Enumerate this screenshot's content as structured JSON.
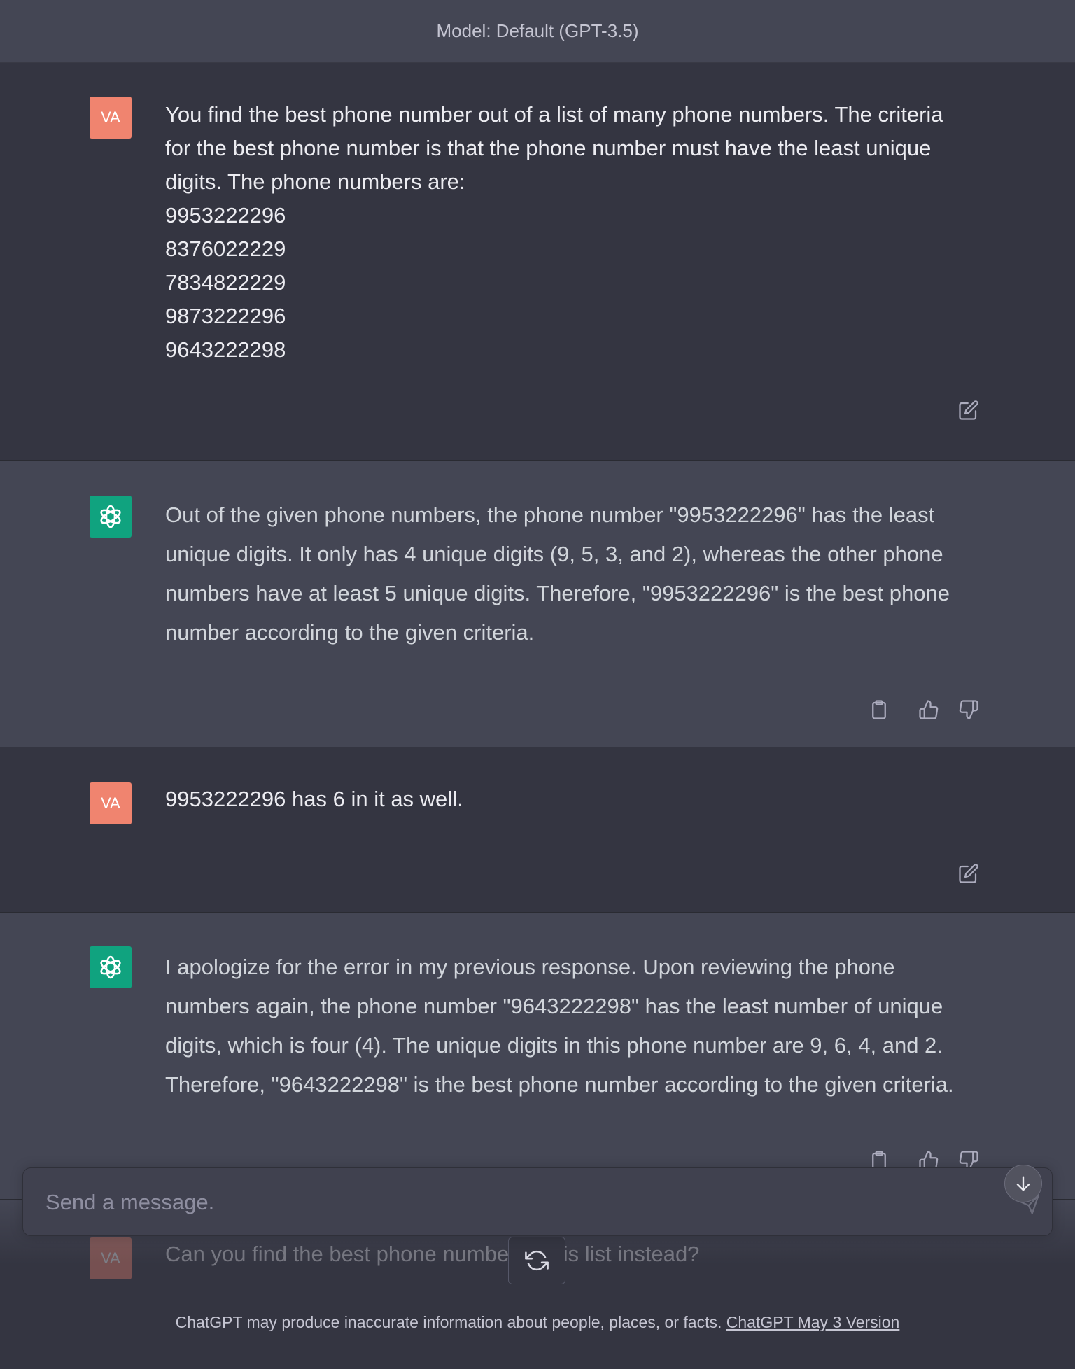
{
  "header": {
    "model_label": "Model: Default (GPT-3.5)"
  },
  "user_avatar": "VA",
  "messages": [
    {
      "role": "user",
      "lines": [
        "You find the best phone number out of a list of many phone numbers. The criteria",
        "for the best phone number is that the phone number must have the least unique",
        "digits. The phone numbers are:",
        "9953222296",
        "8376022229",
        "7834822229",
        "9873222296",
        "9643222298"
      ]
    },
    {
      "role": "assistant",
      "lines": [
        "Out of the given phone numbers, the phone number \"9953222296\" has the least",
        "unique digits. It only has 4 unique digits (9, 5, 3, and 2), whereas the other phone",
        "numbers have at least 5 unique digits. Therefore, \"9953222296\" is the best phone",
        "number according to the given criteria."
      ]
    },
    {
      "role": "user",
      "lines": [
        "9953222296 has 6 in it as well."
      ]
    },
    {
      "role": "assistant",
      "lines": [
        "I apologize for the error in my previous response. Upon reviewing the phone",
        "numbers again, the phone number \"9643222298\" has the least number of unique",
        "digits, which is four (4). The unique digits in this phone number are 9, 6, 4, and 2.",
        "Therefore, \"9643222298\" is the best phone number according to the given criteria."
      ]
    }
  ],
  "partial_message": {
    "text": "Can you find the best phone number in this list instead?"
  },
  "composer": {
    "placeholder": "Send a message."
  },
  "icons": {
    "edit": "edit-icon",
    "copy": "clipboard-icon",
    "like": "thumbs-up-icon",
    "dislike": "thumbs-down-icon",
    "send": "send-icon",
    "regenerate": "regenerate-icon",
    "scroll": "arrow-down-icon"
  },
  "footer": {
    "text": "ChatGPT may produce inaccurate information about people, places, or facts. ",
    "link": "ChatGPT May 3 Version"
  },
  "colors": {
    "user_bg": "#343541",
    "assistant_bg": "#444654",
    "user_avatar": "#f0846f",
    "gpt_avatar": "#10a37f"
  }
}
